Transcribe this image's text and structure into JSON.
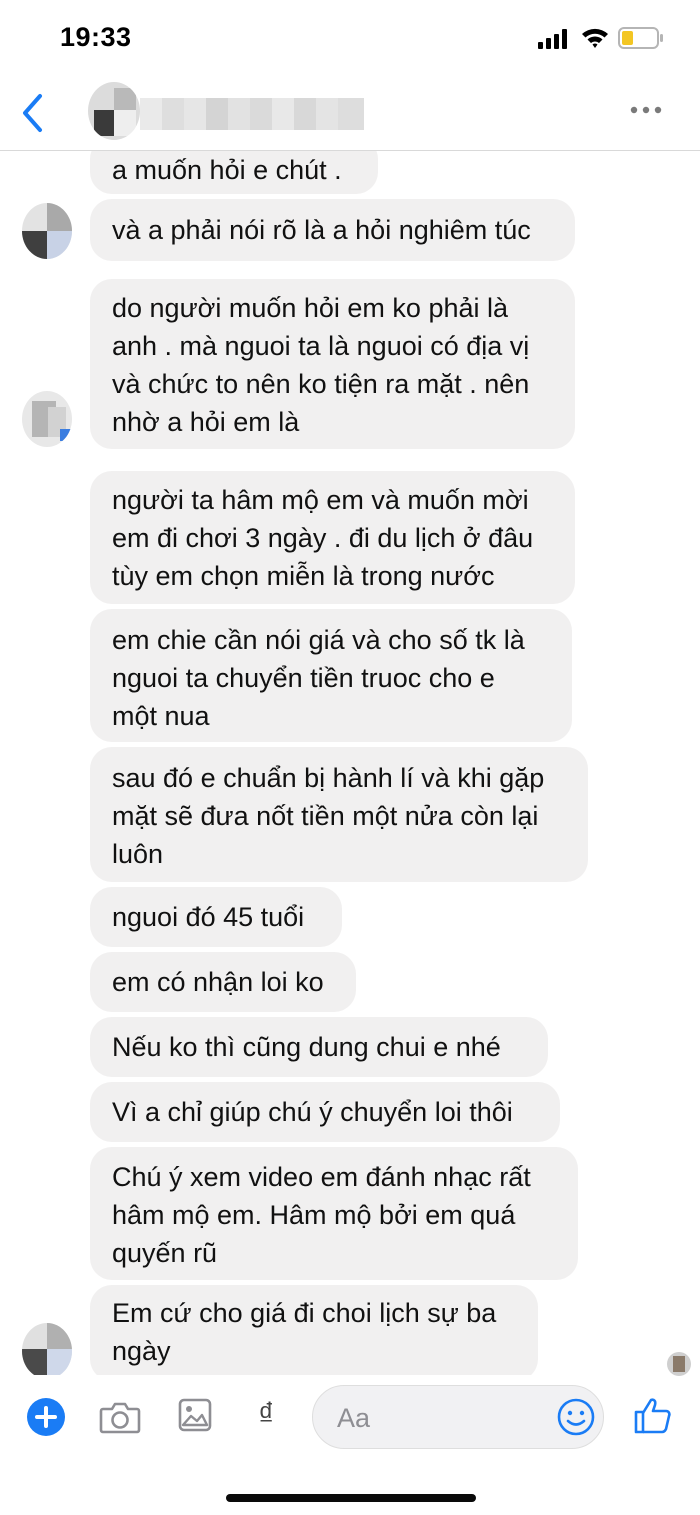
{
  "status_bar": {
    "time": "19:33"
  },
  "composer": {
    "placeholder": "Aa",
    "currency_symbol": "₫"
  },
  "messages": [
    {
      "lines": [
        "a muốn hỏi e chút ."
      ]
    },
    {
      "lines": [
        "và a phải nói rõ là a hỏi nghiêm túc"
      ]
    },
    {
      "lines": [
        "do người muốn hỏi em ko phải là",
        "anh . mà nguoi ta là nguoi có địa vị",
        "và chức to nên ko tiện ra mặt . nên",
        "nhờ a hỏi em là"
      ]
    },
    {
      "lines": [
        "người ta hâm mộ em và muốn mời",
        "em đi chơi 3 ngày . đi du lịch ở đâu",
        "tùy em chọn miễn là trong nước"
      ]
    },
    {
      "lines": [
        "em chie cần nói giá và cho số tk là",
        "nguoi ta chuyển tiền truoc cho e",
        "một nua"
      ]
    },
    {
      "lines": [
        "sau đó e chuẩn bị hành lí và khi gặp",
        "mặt sẽ đưa nốt tiền một nửa còn lại",
        "luôn"
      ]
    },
    {
      "lines": [
        "nguoi đó 45 tuổi"
      ]
    },
    {
      "lines": [
        "em có nhận loi ko"
      ]
    },
    {
      "lines": [
        "Nếu ko thì cũng dung chui e nhé"
      ]
    },
    {
      "lines": [
        "Vì a chỉ giúp chú ý chuyển loi thôi"
      ]
    },
    {
      "lines": [
        "Chú ý xem video em đánh nhạc rất",
        "hâm mộ em. Hâm mộ bởi em quá",
        "quyến rũ"
      ]
    },
    {
      "lines": [
        "Em cứ cho giá đi choi lịch sự ba",
        "ngày"
      ]
    }
  ]
}
